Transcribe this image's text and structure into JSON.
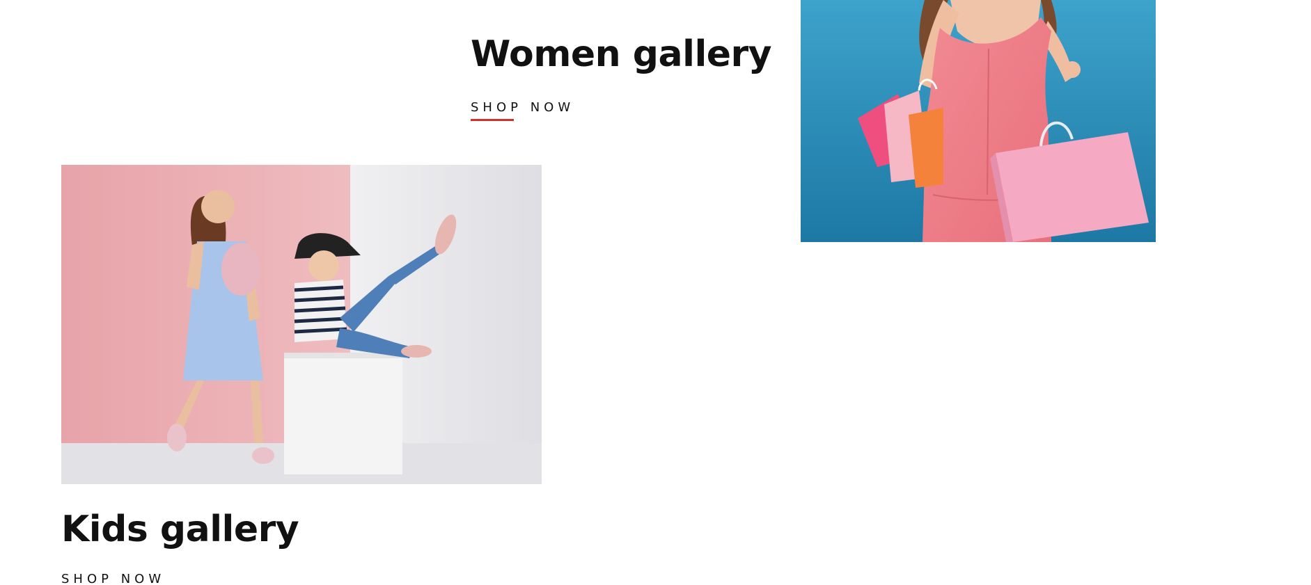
{
  "women": {
    "title": "Women gallery",
    "cta": "SHOP NOW"
  },
  "kids": {
    "title": "Kids gallery",
    "cta": "SHOP NOW"
  },
  "colors": {
    "accent_underline": "#d0312d",
    "women_bg": "#2f93bf",
    "kids_wall_pink": "#e9a9ad",
    "kids_wall_light": "#ebebee"
  },
  "images": {
    "women": "woman-in-pink-dress-with-shopping-bags-photo",
    "kids": "two-girls-posing-with-white-box-photo"
  }
}
